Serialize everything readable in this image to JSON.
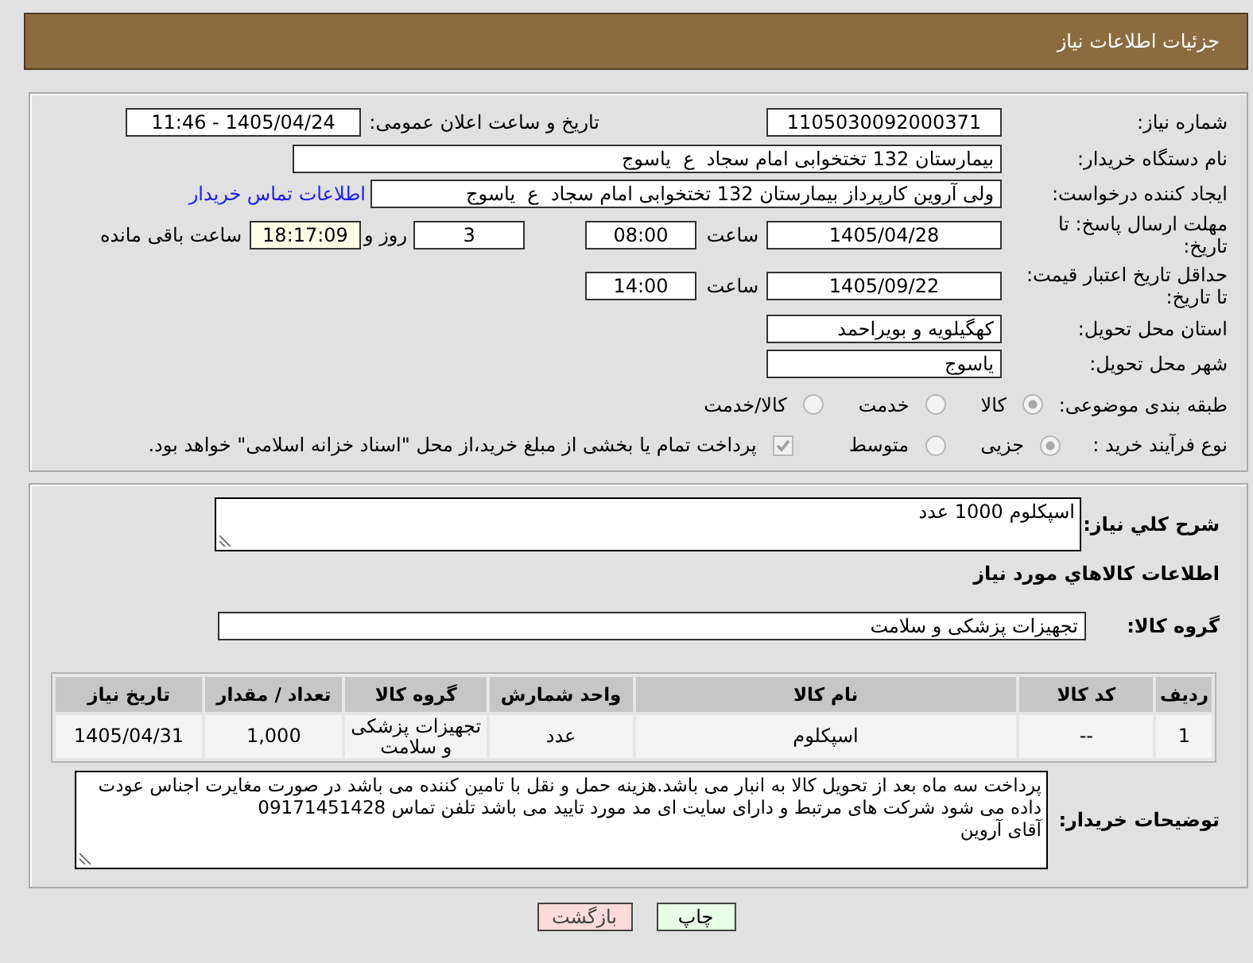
{
  "header": {
    "title": "جزئیات اطلاعات نیاز"
  },
  "summary": {
    "need_number": {
      "label": "شماره نیاز:",
      "value": "1105030092000371"
    },
    "announced": {
      "label": "تاریخ و ساعت اعلان عمومی:",
      "value": "1405/04/24 - 11:46"
    },
    "buyer_org": {
      "label": "نام دستگاه خریدار:",
      "value": "بیمارستان 132 تختخوابی امام سجاد  ع  یاسوج"
    },
    "requester": {
      "label": "ایجاد کننده درخواست:",
      "value": "ولی آروین کارپرداز بیمارستان 132 تختخوابی امام سجاد  ع  یاسوج",
      "link": "اطلاعات تماس خریدار"
    },
    "reply_deadline": {
      "label": "مهلت ارسال پاسخ: تا تاریخ:",
      "date": "1405/04/28",
      "time_label": "ساعت",
      "time": "08:00",
      "days": "3",
      "days_label": "روز و",
      "remaining": "18:17:09",
      "remaining_label": "ساعت باقی مانده"
    },
    "price_validity": {
      "label": "حداقل تاریخ اعتبار قیمت: تا تاریخ:",
      "date": "1405/09/22",
      "time_label": "ساعت",
      "time": "14:00"
    },
    "delivery_province": {
      "label": "استان محل تحویل:",
      "value": "کهگیلویه و بویراحمد"
    },
    "delivery_city": {
      "label": "شهر محل تحویل:",
      "value": "یاسوج"
    },
    "category": {
      "label": "طبقه بندی موضوعی:",
      "disabled": true,
      "options": [
        {
          "label": "کالا",
          "selected": true
        },
        {
          "label": "خدمت",
          "selected": false
        },
        {
          "label": "کالا/خدمت",
          "selected": false
        }
      ]
    },
    "process_type": {
      "label": "نوع فرآیند خرید :",
      "disabled": true,
      "options": [
        {
          "label": "جزیی",
          "selected": true
        },
        {
          "label": "متوسط",
          "selected": false
        }
      ],
      "treasury": {
        "label": "پرداخت تمام یا بخشی از مبلغ خرید،از محل \"اسناد خزانه اسلامی\" خواهد بود.",
        "checked": true,
        "disabled": true
      }
    }
  },
  "needs": {
    "description": {
      "label": "شرح کلي نياز:",
      "value": "اسپکلوم 1000 عدد"
    },
    "section_title": "اطلاعات کالاهاي مورد نياز",
    "goods_group": {
      "label": "گروه کالا:",
      "value": "تجهیزات پزشکی و سلامت"
    },
    "table": {
      "columns": [
        "ردیف",
        "کد کالا",
        "نام کالا",
        "واحد شمارش",
        "گروه کالا",
        "تعداد / مقدار",
        "تاریخ نیاز"
      ],
      "rows": [
        [
          "1",
          "--",
          "اسپکلوم",
          "عدد",
          "تجهیزات پزشکی و سلامت",
          "1,000",
          "1405/04/31"
        ]
      ]
    },
    "buyer_notes": {
      "label": "توضیحات خریدار:",
      "value": "پرداخت سه ماه بعد از تحویل کالا به انبار می باشد.هزینه حمل و نقل با تامین کننده می باشد در صورت مغایرت اجناس عودت داده می شود شرکت های مرتبط و دارای سایت ای مد مورد تایید می باشد تلفن تماس 09171451428\nآقای آروین"
    }
  },
  "buttons": [
    {
      "label": "چاپ",
      "kind": "print"
    },
    {
      "label": "بازگشت",
      "kind": "back"
    }
  ]
}
